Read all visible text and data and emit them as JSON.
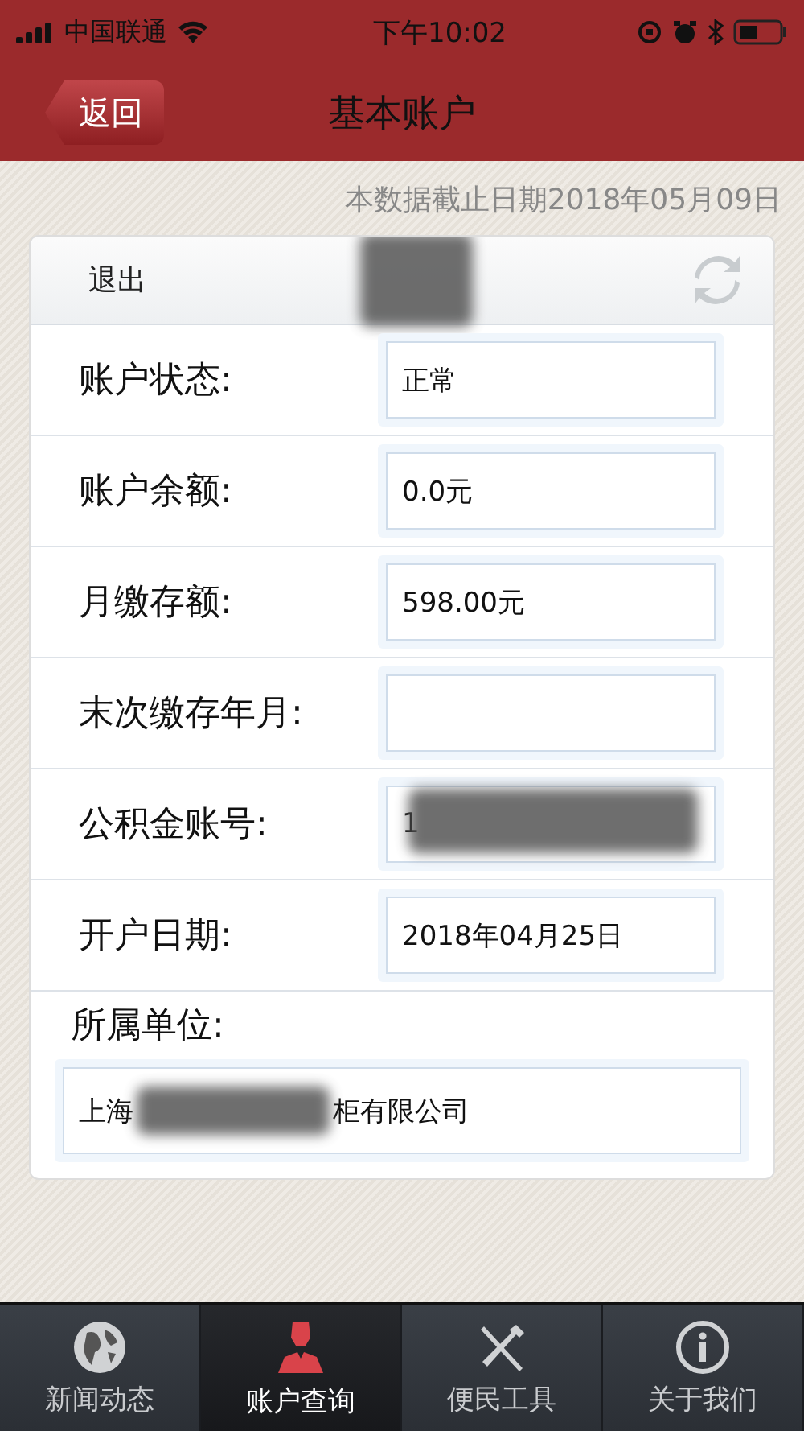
{
  "status_bar": {
    "carrier": "中国联通",
    "time": "下午10:02"
  },
  "nav": {
    "back": "返回",
    "title": "基本账户"
  },
  "data_date": "本数据截止日期2018年05月09日",
  "card": {
    "logout": "退出",
    "name_redacted": true
  },
  "fields": [
    {
      "label": "账户状态:",
      "value": "正常"
    },
    {
      "label": "账户余额:",
      "value": "0.0元"
    },
    {
      "label": "月缴存额:",
      "value": "598.00元"
    },
    {
      "label": "末次缴存年月:"
    },
    {
      "label": "公积金账号:",
      "value": "1",
      "redacted": true
    },
    {
      "label": "开户日期:",
      "value": "2018年04月25日"
    }
  ],
  "employer": {
    "label": "所属单位:",
    "value_start": "上海",
    "value_end": "柜有限公司"
  },
  "tabs": [
    {
      "label": "新闻动态",
      "kind": "globe",
      "selected": false
    },
    {
      "label": "账户查询",
      "kind": "person",
      "selected": true
    },
    {
      "label": "便民工具",
      "kind": "tools",
      "selected": false
    },
    {
      "label": "关于我们",
      "kind": "info",
      "selected": false
    }
  ]
}
